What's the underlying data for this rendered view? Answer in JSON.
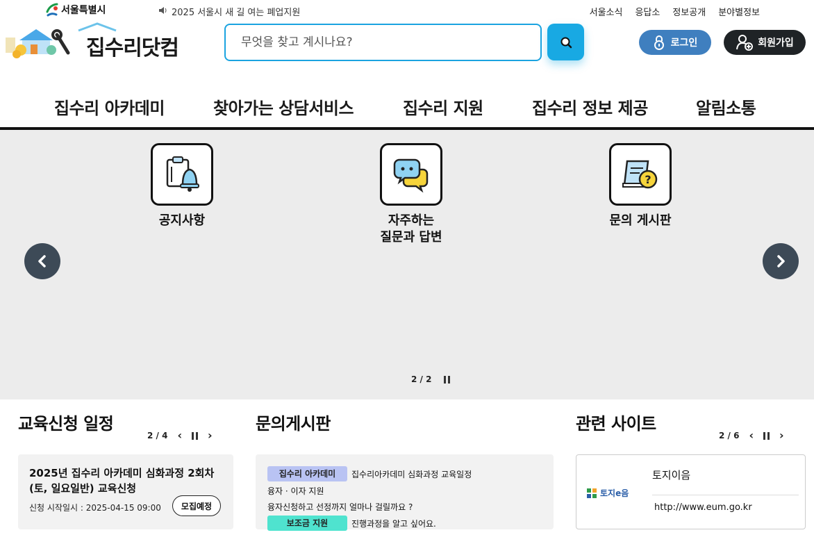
{
  "topbar": {
    "org_name": "서울특별시",
    "notice": "2025 서울시 새 길 여는 폐업지원",
    "links": [
      "서울소식",
      "응답소",
      "정보공개",
      "분야별정보"
    ]
  },
  "header": {
    "logo_text": "집수리닷컴",
    "search_placeholder": "무엇을 찾고 계시나요?",
    "login_label": "로그인",
    "join_label": "회원가입"
  },
  "gnb": {
    "items": [
      "집수리 아카데미",
      "찾아가는 상담서비스",
      "집수리 지원",
      "집수리 정보 제공",
      "알림소통"
    ]
  },
  "hero": {
    "items": [
      {
        "label": "공지사항",
        "icon": "clipboard-bell-icon"
      },
      {
        "label": "자주하는\n질문과 답변",
        "icon": "chat-bubbles-icon"
      },
      {
        "label": "문의 게시판",
        "icon": "document-question-icon"
      }
    ],
    "pager": "2 / 2"
  },
  "education": {
    "title": "교육신청 일정",
    "pager": "2 / 4",
    "card_title": "2025년 집수리 아카데미 심화과정 2회차 (토, 일요일반) 교육신청",
    "card_date": "신청 시작일시 : 2025-04-15 09:00",
    "card_badge": "모집예정"
  },
  "qna": {
    "title": "문의게시판",
    "rows": [
      {
        "tag": "집수리 아카데미",
        "tag_color": "#b9c3f3",
        "text": "집수리아카데미 심화과정 교육일정"
      },
      {
        "tag": "",
        "text": "융자 · 이자 지원"
      },
      {
        "tag": "",
        "text": "융자신청하고 선정까지 얼마나 걸릴까요 ?"
      },
      {
        "tag": "보조금 지원",
        "tag_color": "#4fe3cf",
        "text": "진행과정을 알고 싶어요."
      }
    ]
  },
  "sites": {
    "title": "관련 사이트",
    "pager": "2 / 6",
    "site_name": "토지이음",
    "site_url": "http://www.eum.go.kr",
    "logo_text": "토지e음"
  },
  "colors": {
    "accent": "#18a9e3",
    "login": "#3f7fbf",
    "join": "#1f2326",
    "hero_bg": "#ececec"
  }
}
